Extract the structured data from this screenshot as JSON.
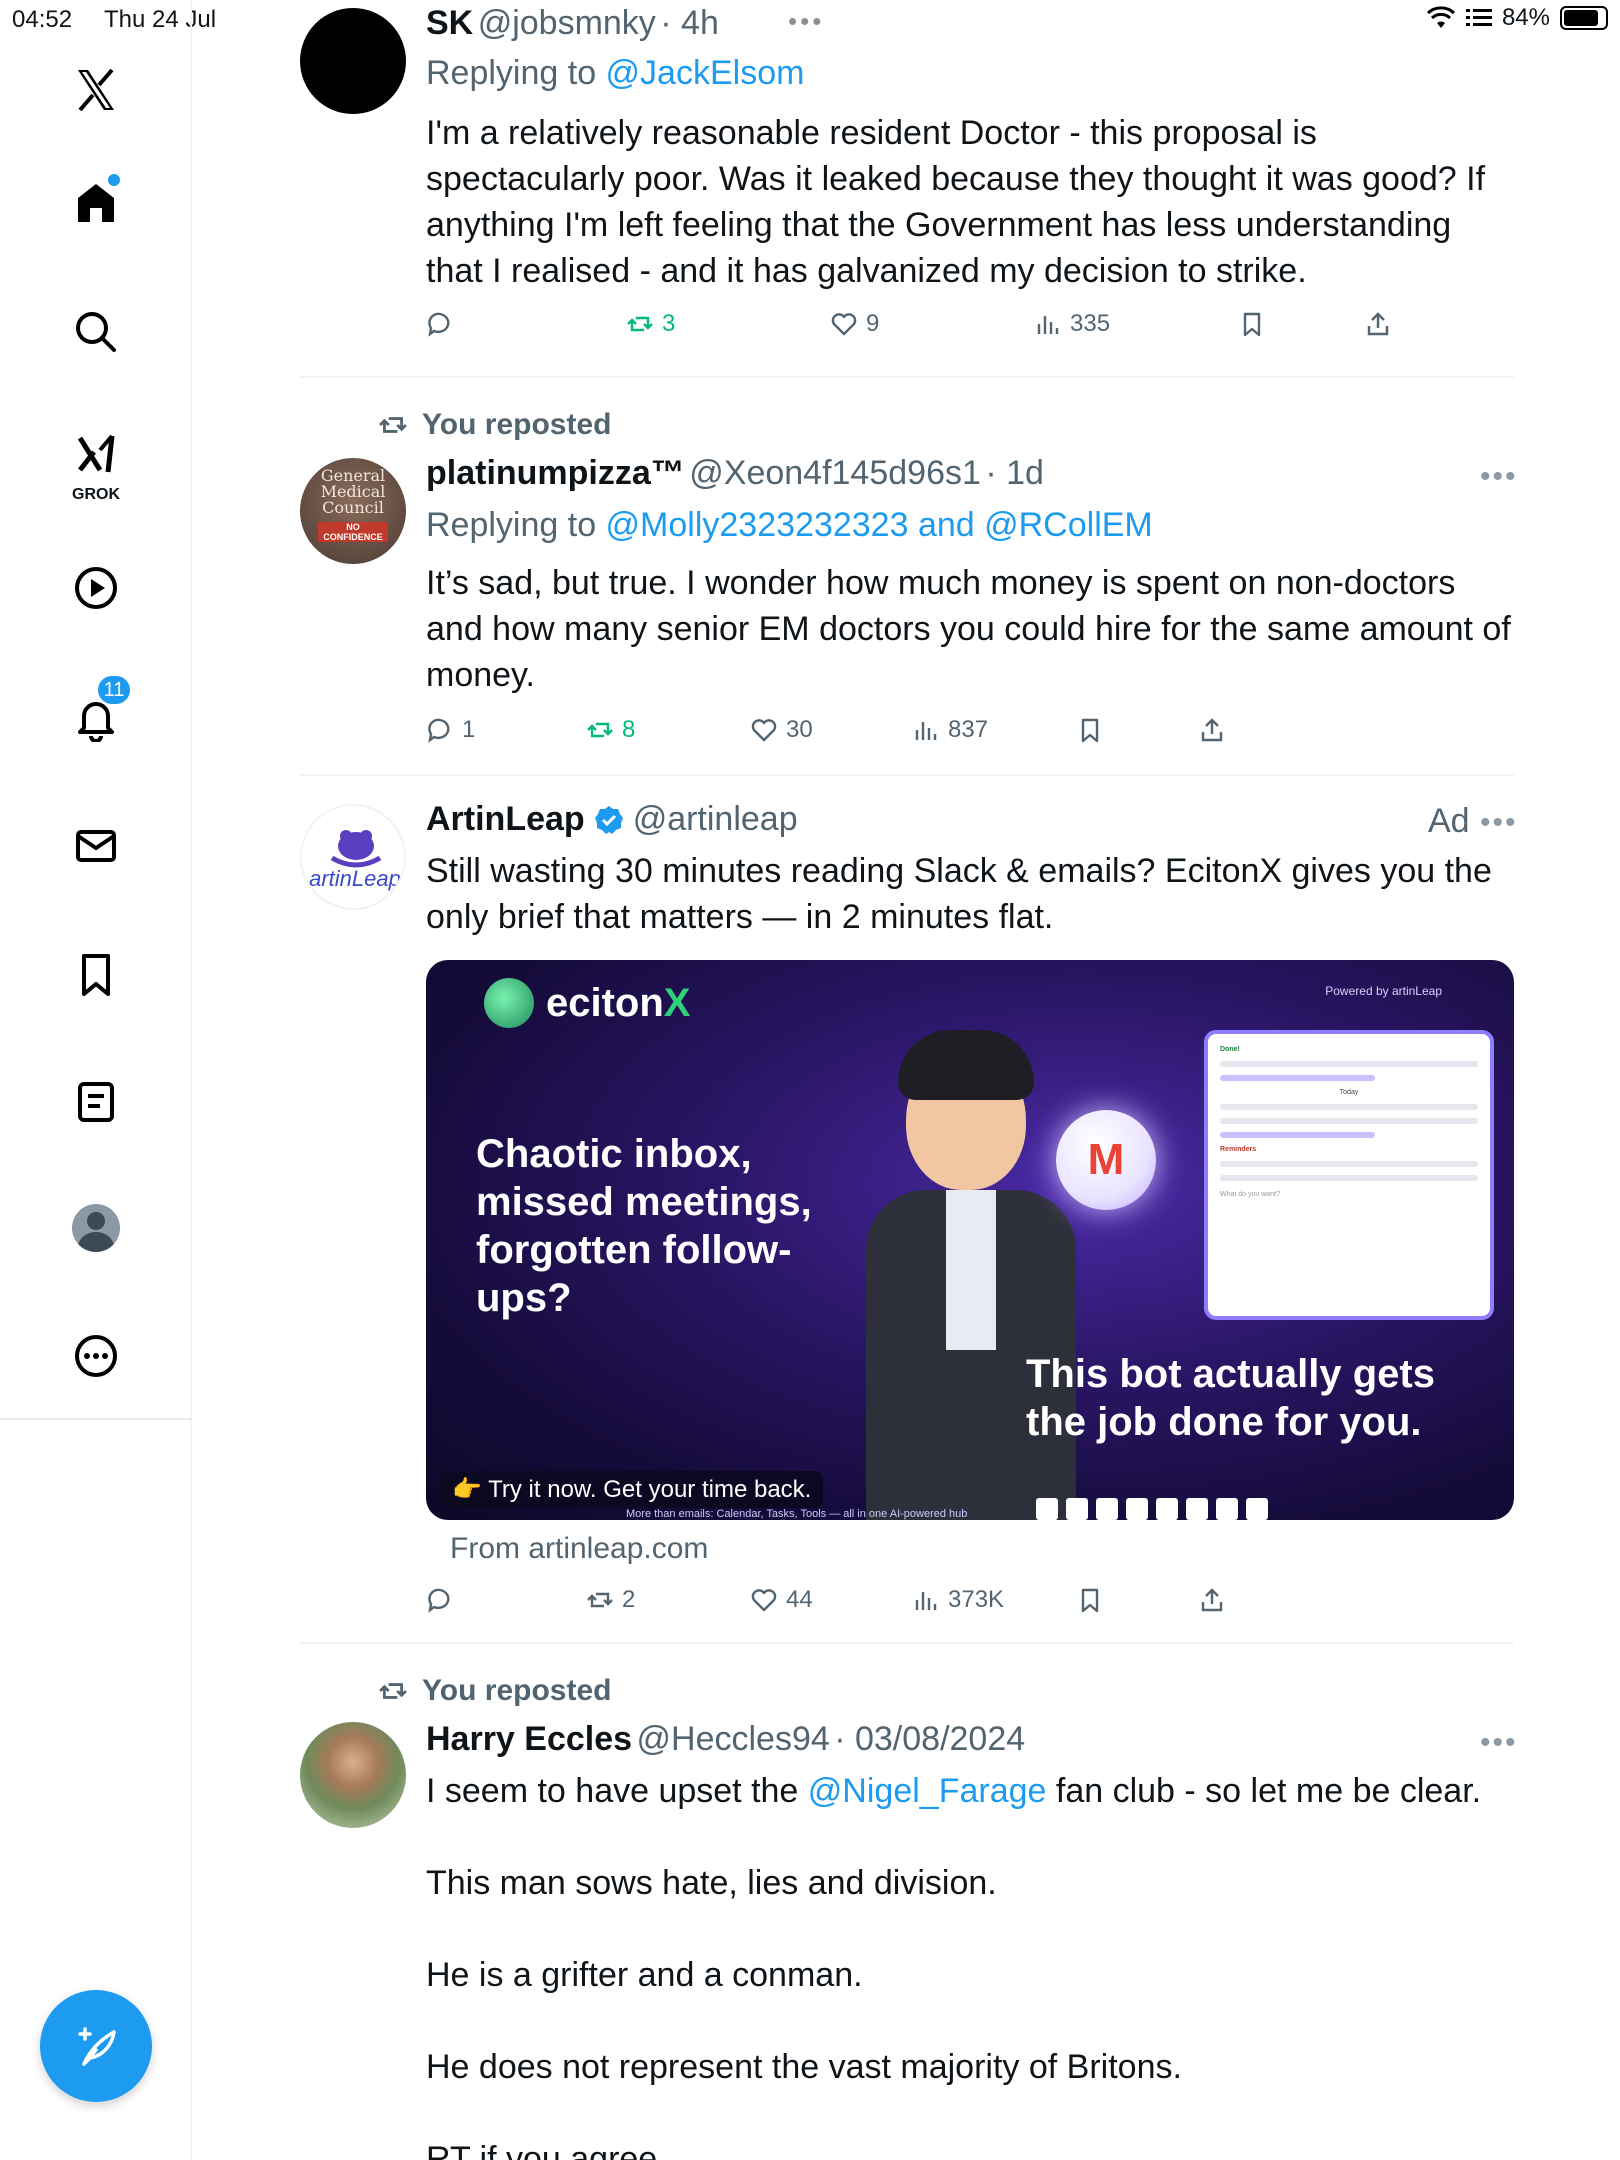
{
  "status_bar": {
    "time": "04:52",
    "date": "Thu 24 Jul",
    "battery": "84%",
    "battery_level": 0.84
  },
  "nav": {
    "notifications_badge": "11",
    "grok_label": "GROK"
  },
  "tweets": [
    {
      "name": "SK",
      "handle": "@jobsmnky",
      "time": "· 4h",
      "replying_prefix": "Replying to ",
      "replying_to": "@JackElsom",
      "body": "I'm a relatively reasonable resident Doctor - this proposal is spectacularly poor. Was it leaked because they thought it was good? If anything I'm left feeling that the Government has less understanding that I realised - and it has galvanized my decision to strike.",
      "reposts": "3",
      "likes": "9",
      "views": "335"
    },
    {
      "repost_label": "You reposted",
      "name": "platinumpizza™",
      "handle": "@Xeon4f145d96s1",
      "time": "· 1d",
      "replying_prefix": "Replying to ",
      "replying_to": "@Molly2323232323 and @RCollEM",
      "body": "It’s sad, but true. I wonder how much money is spent on non-doctors and how many senior EM doctors you could hire for the same amount of money.",
      "avatar_text": "General Medical Council",
      "avatar_sub": "NO CONFIDENCE",
      "replies": "1",
      "reposts": "8",
      "likes": "30",
      "views": "837"
    },
    {
      "name": "ArtinLeap",
      "handle": "@artinleap",
      "ad_label": "Ad",
      "body": "Still wasting 30 minutes reading Slack & emails? EcitonX gives you the only brief that matters — in 2 minutes flat.",
      "avatar_text": "artinLeap",
      "from": "From artinleap.com",
      "reposts": "2",
      "likes": "44",
      "views": "373K",
      "card": {
        "brand": "eciton",
        "brand_x": "X",
        "powered_by": "Powered by artinLeap",
        "headline": "Chaotic inbox, missed meetings, forgotten follow-ups?",
        "subline": "This bot actually gets the job done for you.",
        "cta": "👉 Try it now. Get your time back.",
        "tagline": "More than emails: Calendar, Tasks, Tools — all in one AI-powered hub",
        "panel_done": "Done!",
        "panel_today": "Today",
        "panel_reminders": "Reminders",
        "panel_placeholder": "What do you want?",
        "orb_letter": "M"
      }
    },
    {
      "repost_label": "You reposted",
      "name": "Harry Eccles",
      "handle": "@Heccles94",
      "time": "· 03/08/2024",
      "body_prefix": "I seem to have upset the ",
      "body_mention": "@Nigel_Farage",
      "body_suffix": " fan club - so let me be clear.",
      "line2": "This man sows hate, lies and division.",
      "line3": "He is a grifter and a conman.",
      "line4": "He does not represent the vast majority of Britons.",
      "line5": "RT if you agree"
    }
  ],
  "colors": {
    "accent": "#1d9bf0",
    "repost_green": "#00ba7c",
    "secondary_text": "#536471"
  }
}
